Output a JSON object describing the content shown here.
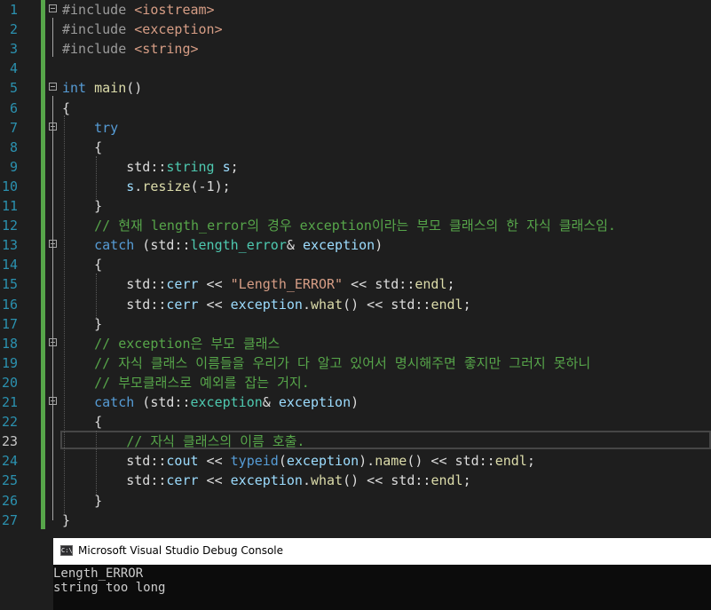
{
  "editor": {
    "current_line": 23,
    "lines": [
      {
        "n": "1",
        "tokens": [
          {
            "t": "#include ",
            "c": "pp"
          },
          {
            "t": "<iostream>",
            "c": "str"
          }
        ]
      },
      {
        "n": "2",
        "tokens": [
          {
            "t": "#include ",
            "c": "pp"
          },
          {
            "t": "<exception>",
            "c": "str"
          }
        ]
      },
      {
        "n": "3",
        "tokens": [
          {
            "t": "#include ",
            "c": "pp"
          },
          {
            "t": "<string>",
            "c": "str"
          }
        ]
      },
      {
        "n": "4",
        "tokens": []
      },
      {
        "n": "5",
        "tokens": [
          {
            "t": "int",
            "c": "kw"
          },
          {
            "t": " "
          },
          {
            "t": "main",
            "c": "fn"
          },
          {
            "t": "()"
          }
        ]
      },
      {
        "n": "6",
        "tokens": [
          {
            "t": "{"
          }
        ]
      },
      {
        "n": "7",
        "tokens": [
          {
            "t": "    "
          },
          {
            "t": "try",
            "c": "kw"
          }
        ]
      },
      {
        "n": "8",
        "tokens": [
          {
            "t": "    {"
          }
        ]
      },
      {
        "n": "9",
        "tokens": [
          {
            "t": "        std::"
          },
          {
            "t": "string",
            "c": "ty"
          },
          {
            "t": " "
          },
          {
            "t": "s",
            "c": "pv"
          },
          {
            "t": ";"
          }
        ]
      },
      {
        "n": "10",
        "tokens": [
          {
            "t": "        "
          },
          {
            "t": "s",
            "c": "pv"
          },
          {
            "t": "."
          },
          {
            "t": "resize",
            "c": "fn"
          },
          {
            "t": "(-1);"
          }
        ]
      },
      {
        "n": "11",
        "tokens": [
          {
            "t": "    }"
          }
        ]
      },
      {
        "n": "12",
        "tokens": [
          {
            "t": "    "
          },
          {
            "t": "// 현재 length_error의 경우 exception이라는 부모 클래스의 한 자식 클래스임.",
            "c": "cm"
          }
        ]
      },
      {
        "n": "13",
        "tokens": [
          {
            "t": "    "
          },
          {
            "t": "catch",
            "c": "kw"
          },
          {
            "t": " (std::"
          },
          {
            "t": "length_error",
            "c": "ty"
          },
          {
            "t": "& "
          },
          {
            "t": "exception",
            "c": "pv"
          },
          {
            "t": ")"
          }
        ]
      },
      {
        "n": "14",
        "tokens": [
          {
            "t": "    {"
          }
        ]
      },
      {
        "n": "15",
        "tokens": [
          {
            "t": "        std::"
          },
          {
            "t": "cerr",
            "c": "pv"
          },
          {
            "t": " << "
          },
          {
            "t": "\"Length_ERROR\"",
            "c": "str"
          },
          {
            "t": " << std::"
          },
          {
            "t": "endl",
            "c": "fn"
          },
          {
            "t": ";"
          }
        ]
      },
      {
        "n": "16",
        "tokens": [
          {
            "t": "        std::"
          },
          {
            "t": "cerr",
            "c": "pv"
          },
          {
            "t": " << "
          },
          {
            "t": "exception",
            "c": "pv"
          },
          {
            "t": "."
          },
          {
            "t": "what",
            "c": "fn"
          },
          {
            "t": "() << std::"
          },
          {
            "t": "endl",
            "c": "fn"
          },
          {
            "t": ";"
          }
        ]
      },
      {
        "n": "17",
        "tokens": [
          {
            "t": "    }"
          }
        ]
      },
      {
        "n": "18",
        "tokens": [
          {
            "t": "    "
          },
          {
            "t": "// exception은 부모 클래스",
            "c": "cm"
          }
        ]
      },
      {
        "n": "19",
        "tokens": [
          {
            "t": "    "
          },
          {
            "t": "// 자식 클래스 이름들을 우리가 다 알고 있어서 명시해주면 좋지만 그러지 못하니",
            "c": "cm"
          }
        ]
      },
      {
        "n": "20",
        "tokens": [
          {
            "t": "    "
          },
          {
            "t": "// 부모클래스로 예외를 잡는 거지.",
            "c": "cm"
          }
        ]
      },
      {
        "n": "21",
        "tokens": [
          {
            "t": "    "
          },
          {
            "t": "catch",
            "c": "kw"
          },
          {
            "t": " (std::"
          },
          {
            "t": "exception",
            "c": "ty"
          },
          {
            "t": "& "
          },
          {
            "t": "exception",
            "c": "pv"
          },
          {
            "t": ")"
          }
        ]
      },
      {
        "n": "22",
        "tokens": [
          {
            "t": "    {"
          }
        ]
      },
      {
        "n": "23",
        "tokens": [
          {
            "t": "        "
          },
          {
            "t": "// 자식 클래스의 이름 호출.",
            "c": "cm"
          }
        ]
      },
      {
        "n": "24",
        "tokens": [
          {
            "t": "        std::"
          },
          {
            "t": "cout",
            "c": "pv"
          },
          {
            "t": " << "
          },
          {
            "t": "typeid",
            "c": "kw"
          },
          {
            "t": "("
          },
          {
            "t": "exception",
            "c": "pv"
          },
          {
            "t": ")."
          },
          {
            "t": "name",
            "c": "fn"
          },
          {
            "t": "() << std::"
          },
          {
            "t": "endl",
            "c": "fn"
          },
          {
            "t": ";"
          }
        ]
      },
      {
        "n": "25",
        "tokens": [
          {
            "t": "        std::"
          },
          {
            "t": "cerr",
            "c": "pv"
          },
          {
            "t": " << "
          },
          {
            "t": "exception",
            "c": "pv"
          },
          {
            "t": "."
          },
          {
            "t": "what",
            "c": "fn"
          },
          {
            "t": "() << std::"
          },
          {
            "t": "endl",
            "c": "fn"
          },
          {
            "t": ";"
          }
        ]
      },
      {
        "n": "26",
        "tokens": [
          {
            "t": "    }"
          }
        ]
      },
      {
        "n": "27",
        "tokens": [
          {
            "t": "}"
          }
        ]
      }
    ]
  },
  "console": {
    "icon_label": "C:\\",
    "title": "Microsoft Visual Studio Debug Console",
    "output": [
      "Length_ERROR",
      "string too long"
    ]
  },
  "colors": {
    "background": "#1e1e1e",
    "keyword": "#569cd6",
    "type": "#4ec9b0",
    "function": "#dcdcaa",
    "string": "#d69d85",
    "comment": "#57a64a",
    "line_number": "#2b91af"
  }
}
